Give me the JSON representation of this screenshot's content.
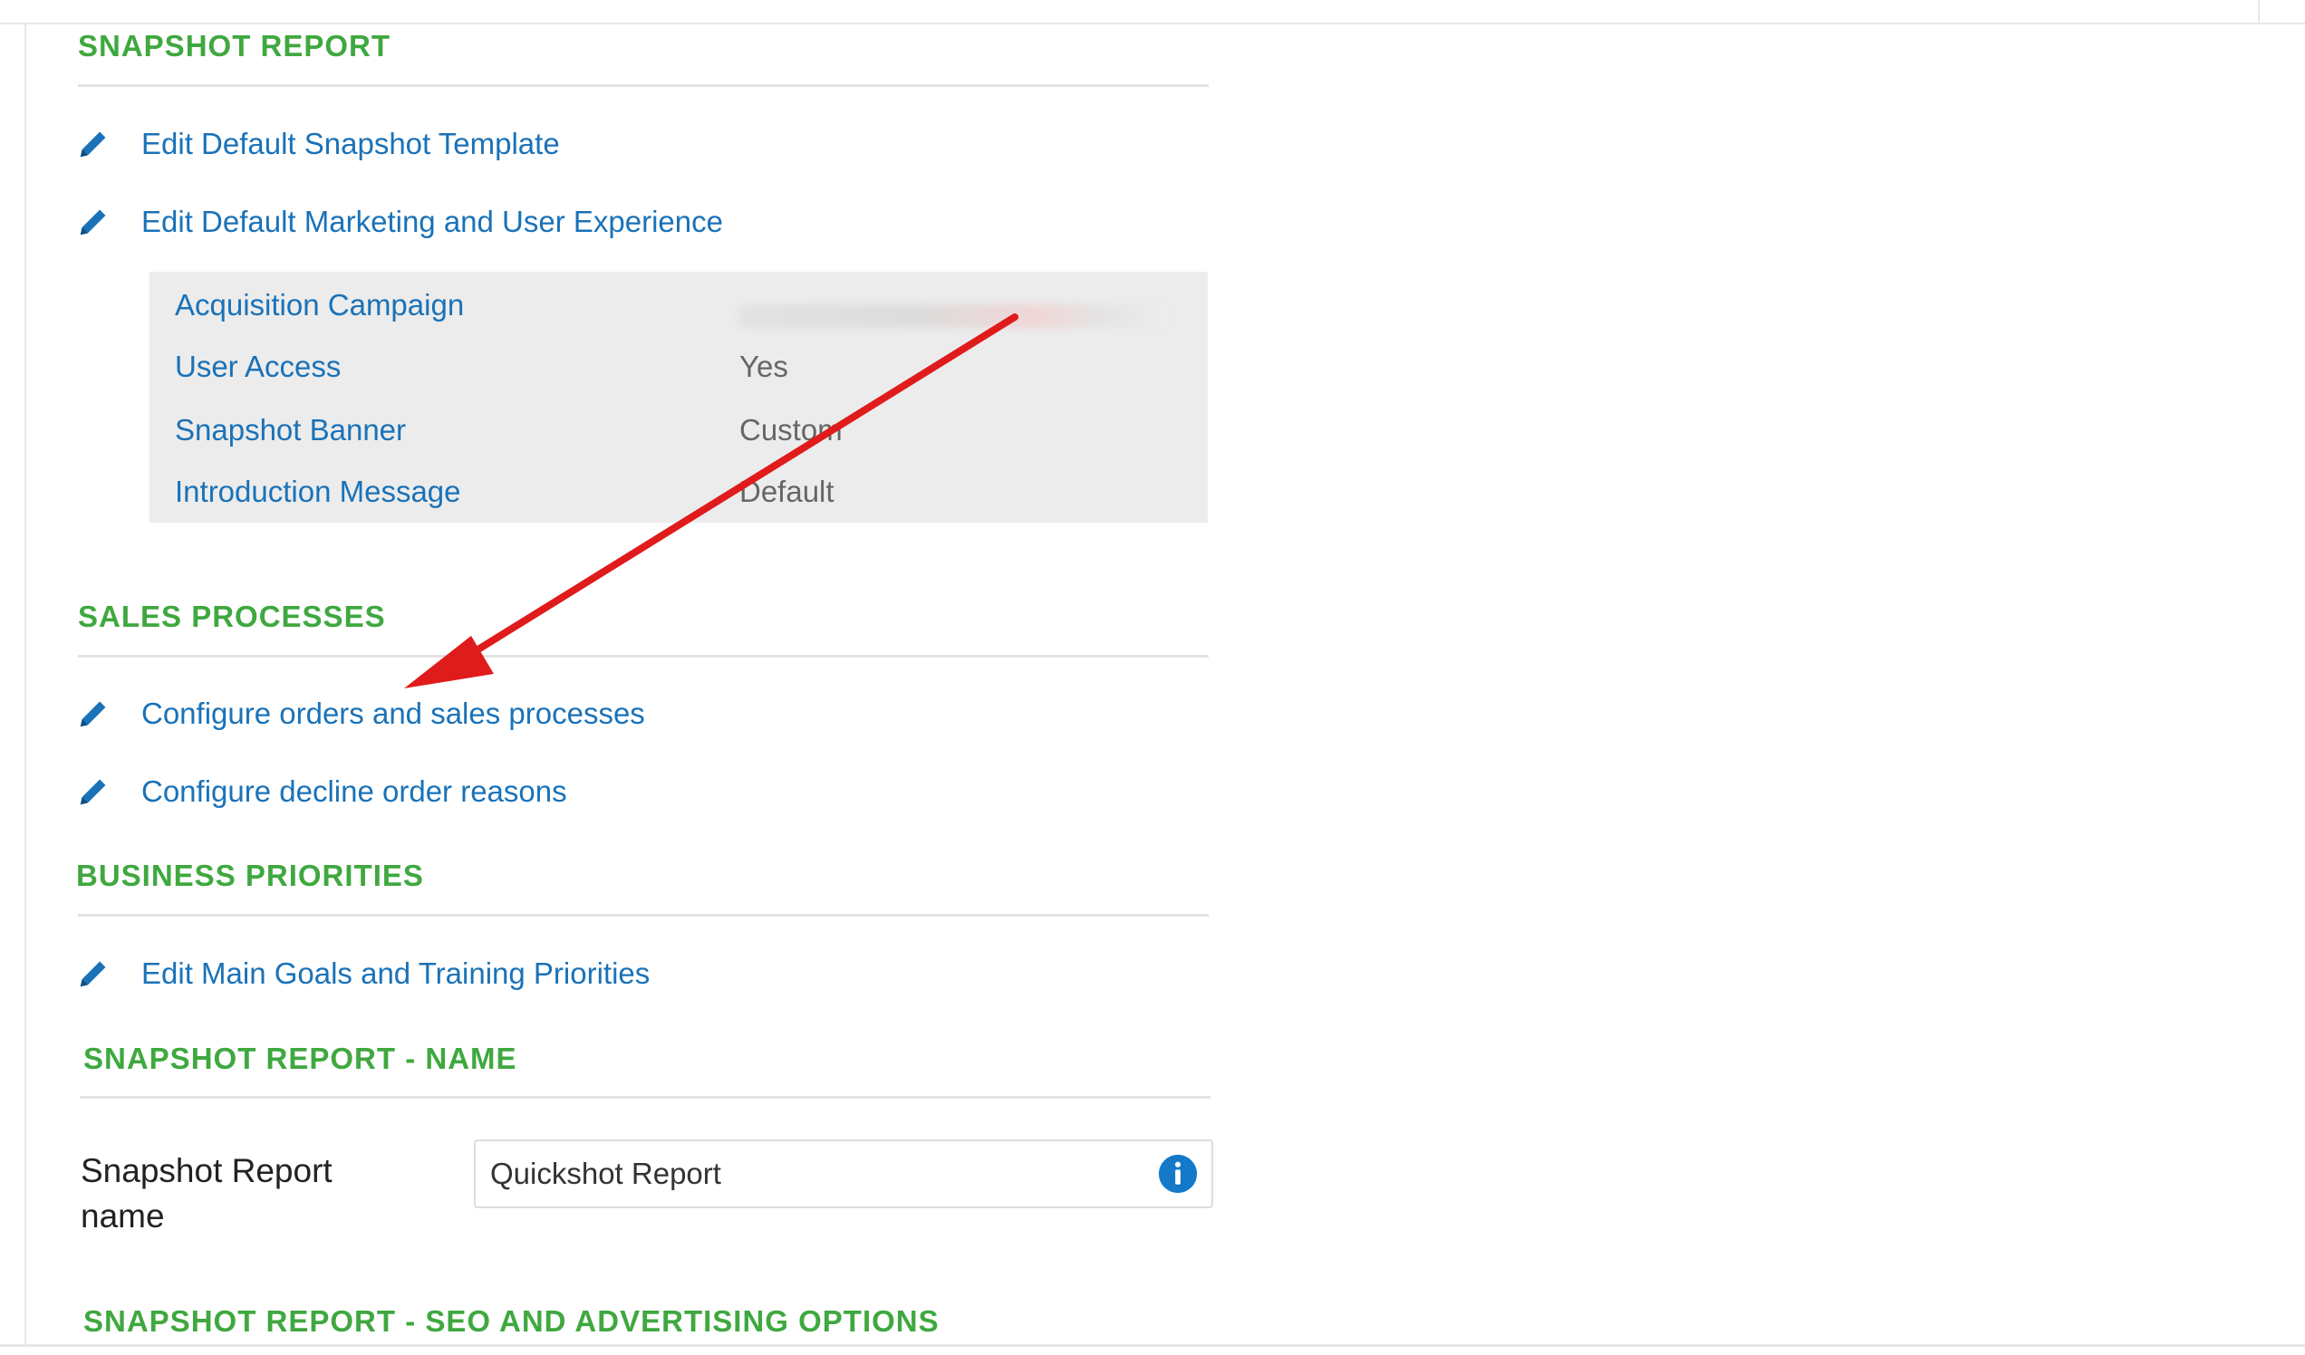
{
  "sections": {
    "snapshot_report": {
      "title": "SNAPSHOT REPORT",
      "links": [
        {
          "label": "Edit Default Snapshot Template",
          "icon": "pencil-icon"
        },
        {
          "label": "Edit Default Marketing and User Experience",
          "icon": "pencil-icon"
        }
      ],
      "summary": [
        {
          "key": "Acquisition Campaign",
          "value": ""
        },
        {
          "key": "User Access",
          "value": "Yes"
        },
        {
          "key": "Snapshot Banner",
          "value": "Custom"
        },
        {
          "key": "Introduction Message",
          "value": "Default"
        }
      ]
    },
    "sales_processes": {
      "title": "SALES PROCESSES",
      "links": [
        {
          "label": "Configure orders and sales processes",
          "icon": "pencil-icon"
        },
        {
          "label": "Configure decline order reasons",
          "icon": "pencil-icon"
        }
      ]
    },
    "business_priorities": {
      "title": "BUSINESS PRIORITIES",
      "links": [
        {
          "label": "Edit Main Goals and Training Priorities",
          "icon": "pencil-icon"
        }
      ]
    },
    "snapshot_report_name": {
      "title": "SNAPSHOT REPORT - NAME",
      "field_label": "Snapshot Report name",
      "field_value": "Quickshot Report",
      "info_icon": "info-icon"
    },
    "seo": {
      "title": "SNAPSHOT REPORT - SEO AND ADVERTISING OPTIONS"
    }
  },
  "colors": {
    "section_title": "#3fa83f",
    "link": "#1a72b8",
    "annotation_arrow": "#e01b1b",
    "info_icon": "#1479c9"
  }
}
